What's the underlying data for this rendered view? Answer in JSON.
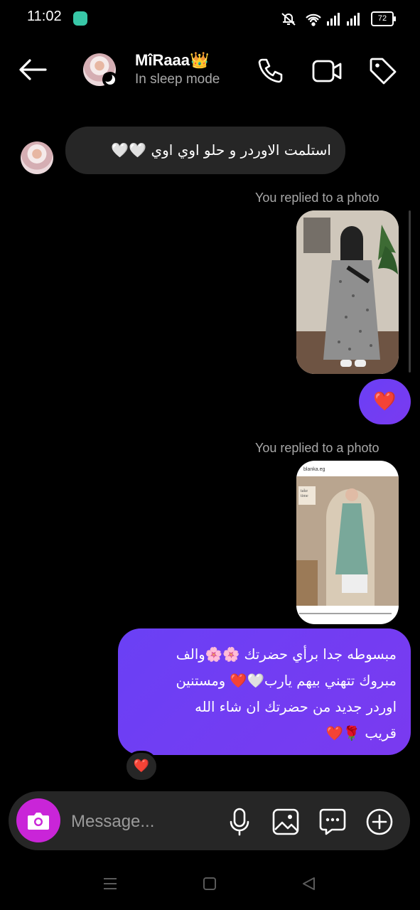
{
  "status_bar": {
    "time": "11:02",
    "battery": "72"
  },
  "header": {
    "name": "MîRaaa👑",
    "status": "In sleep mode"
  },
  "messages": {
    "incoming_1": "استلمت الاوردر و حلو اوي اوي 🤍🤍",
    "replied_label_1": "You replied to a photo",
    "reaction_heart": "❤️",
    "replied_label_2": "You replied to a photo",
    "photo_2_top_label": "blanka.eg",
    "photo_2_sign": "take time",
    "outgoing_long_lines": [
      "مبسوطه جدا برأي حضرتك 🌸🌸والف",
      "مبروك  تتهني بيهم يارب🤍❤️ ومستنين",
      "اوردر جديد من حضرتك ان شاء الله",
      "قريب 🌹❤️"
    ],
    "long_message_reaction": "❤️"
  },
  "composer": {
    "placeholder": "Message..."
  },
  "colors": {
    "outgoing": "#6a40f5",
    "camera_button": "#c925d8",
    "background": "#000000"
  },
  "icons": [
    "back-arrow-icon",
    "phone-icon",
    "video-icon",
    "tag-icon",
    "camera-icon",
    "mic-icon",
    "gallery-icon",
    "sticker-icon",
    "plus-icon",
    "menu-nav-icon",
    "home-nav-icon",
    "back-nav-icon"
  ]
}
